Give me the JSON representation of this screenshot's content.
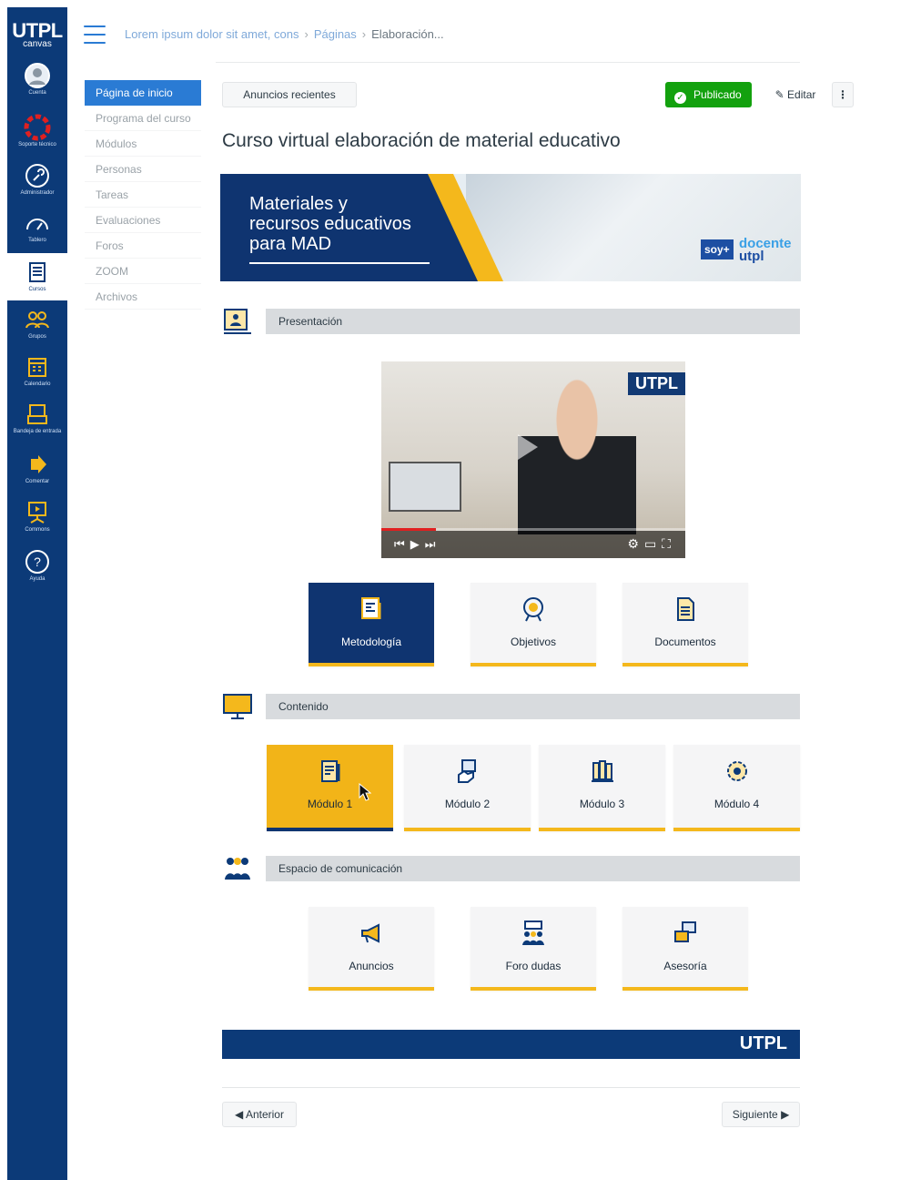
{
  "global_nav": {
    "brand_main": "UTPL",
    "brand_sub": "canvas",
    "items": [
      {
        "label": "Cuenta",
        "icon": "user-avatar-icon"
      },
      {
        "label": "Soporte técnico",
        "icon": "lifebuoy-icon"
      },
      {
        "label": "Administrador",
        "icon": "shield-key-icon"
      },
      {
        "label": "Tablero",
        "icon": "dashboard-gauge-icon"
      },
      {
        "label": "Cursos",
        "icon": "book-icon"
      },
      {
        "label": "Grupos",
        "icon": "groups-icon"
      },
      {
        "label": "Calendario",
        "icon": "calendar-icon"
      },
      {
        "label": "Bandeja de entrada",
        "icon": "inbox-icon"
      },
      {
        "label": "Comentar",
        "icon": "arrow-right-icon"
      },
      {
        "label": "Commons",
        "icon": "commons-icon"
      },
      {
        "label": "Ayuda",
        "icon": "help-icon"
      }
    ]
  },
  "breadcrumb": {
    "course": "Lorem ipsum dolor sit amet, cons",
    "section": "Páginas",
    "current": "Elaboración..."
  },
  "course_nav": [
    "Página de inicio",
    "Programa del curso",
    "Módulos",
    "Personas",
    "Tareas",
    "Evaluaciones",
    "Foros",
    "ZOOM",
    "Archivos"
  ],
  "header": {
    "announcements_button": "Anuncios recientes",
    "published_label": "Publicado",
    "edit_label": "Editar",
    "more_label": "⋮",
    "page_title": "Curso virtual elaboración de material educativo"
  },
  "banner": {
    "line1": "Materiales y",
    "line2": "recursos educativos",
    "line3": "para MAD",
    "badge_soy": "soy+",
    "badge_docente": "docente",
    "badge_utpl": "utpl"
  },
  "sections": {
    "presentation": "Presentación",
    "content": "Contenido",
    "communication": "Espacio de comunicación"
  },
  "video": {
    "watermark": "UTPL"
  },
  "presentation_tiles": [
    {
      "label": "Metodología",
      "icon": "methodology-icon"
    },
    {
      "label": "Objetivos",
      "icon": "target-icon"
    },
    {
      "label": "Documentos",
      "icon": "document-icon"
    }
  ],
  "module_tiles": [
    {
      "label": "Módulo 1",
      "icon": "module-book-icon"
    },
    {
      "label": "Módulo 2",
      "icon": "module-hand-icon"
    },
    {
      "label": "Módulo 3",
      "icon": "module-books-icon"
    },
    {
      "label": "Módulo 4",
      "icon": "module-gear-icon"
    }
  ],
  "communication_tiles": [
    {
      "label": "Anuncios",
      "icon": "megaphone-icon"
    },
    {
      "label": "Foro dudas",
      "icon": "forum-people-icon"
    },
    {
      "label": "Asesoría",
      "icon": "consulting-icon"
    }
  ],
  "footer_brand": "UTPL",
  "pagination": {
    "prev": "Anterior",
    "next": "Siguiente"
  },
  "colors": {
    "navy": "#0c3a78",
    "gold": "#f4b81c",
    "link_blue": "#2a7bd4",
    "published_green": "#13a10e"
  }
}
